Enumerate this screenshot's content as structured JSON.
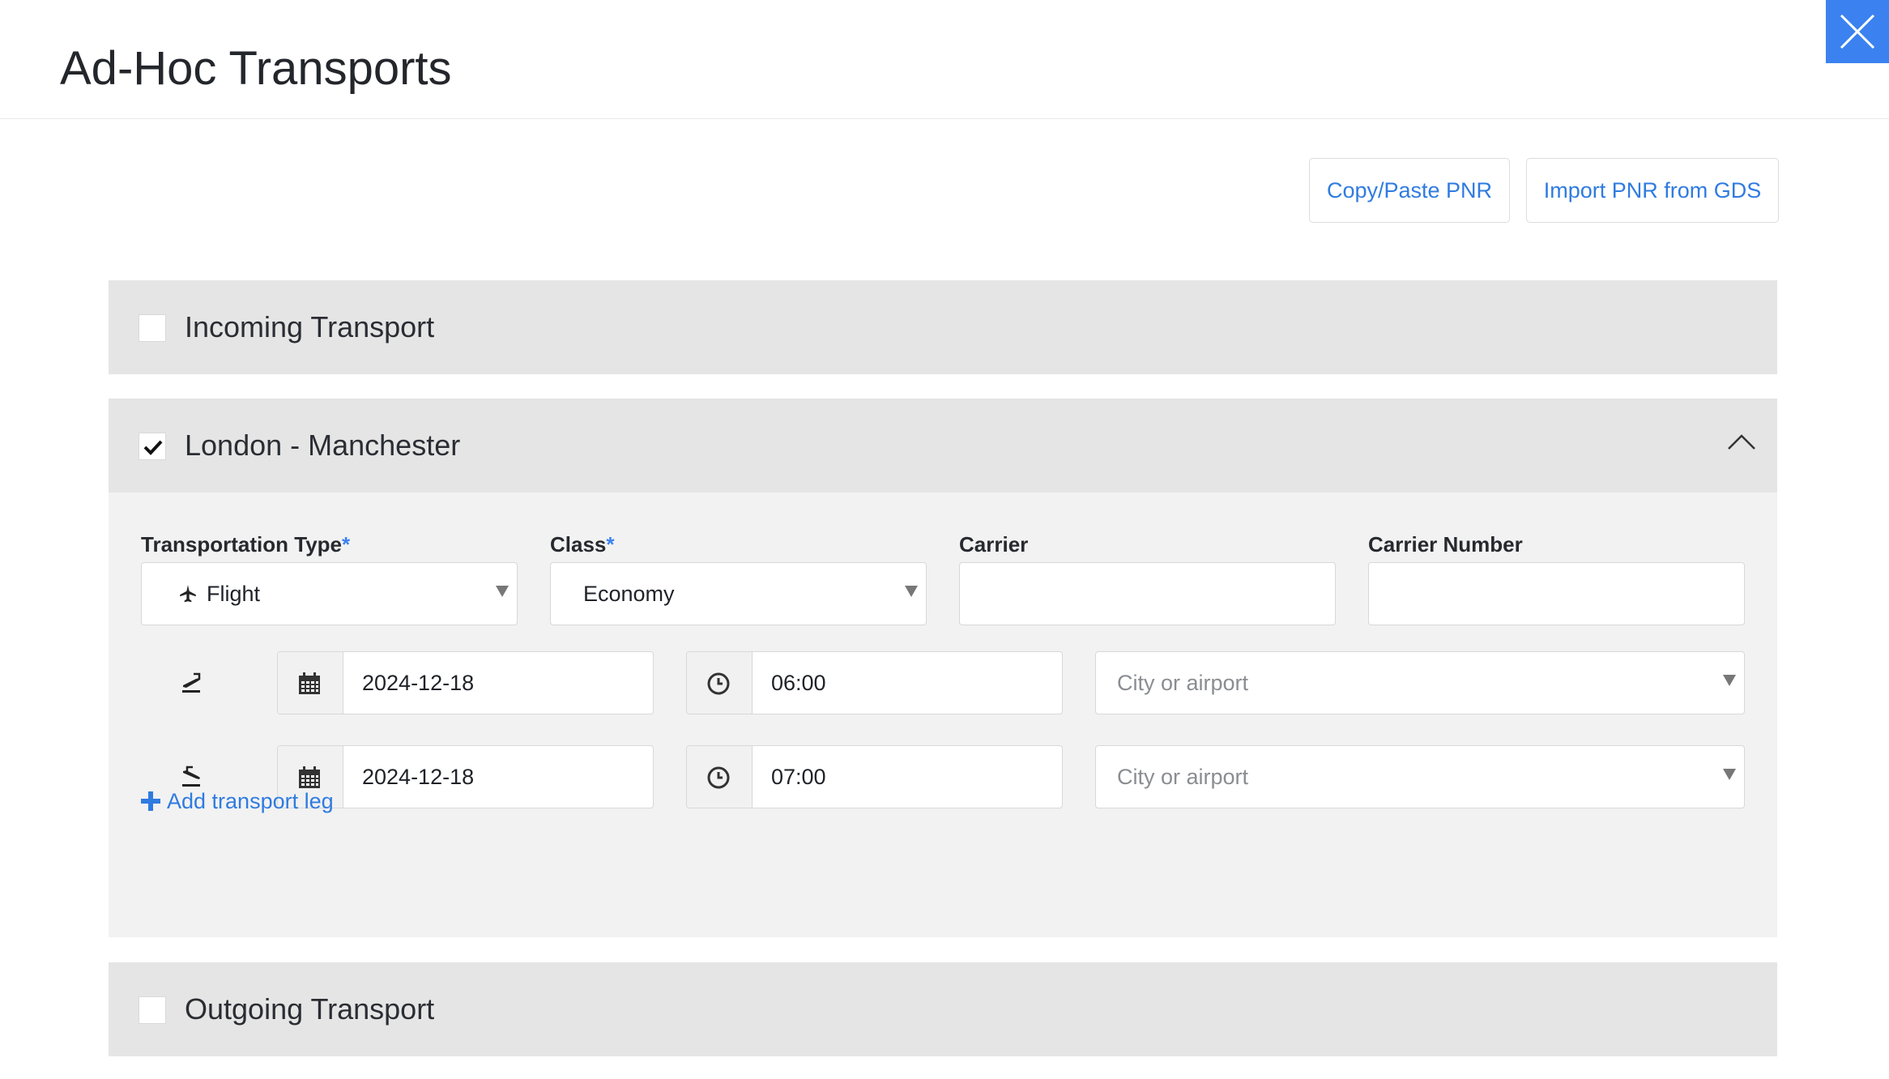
{
  "page": {
    "title": "Ad-Hoc Transports"
  },
  "toolbar": {
    "copy_paste_pnr": "Copy/Paste PNR",
    "import_pnr": "Import PNR from GDS"
  },
  "sections": {
    "incoming": {
      "title": "Incoming Transport",
      "checked": false
    },
    "segment": {
      "title": "London - Manchester",
      "checked": true,
      "expanded": true,
      "labels": {
        "transportation_type": "Transportation Type",
        "class": "Class",
        "carrier": "Carrier",
        "carrier_number": "Carrier Number",
        "required_mark": "*"
      },
      "values": {
        "transportation_type": "Flight",
        "class": "Economy",
        "carrier": "",
        "carrier_number": ""
      },
      "departure": {
        "date": "2024-12-18",
        "time": "06:00",
        "location_placeholder": "City or airport",
        "icon": "plane-departure-icon"
      },
      "arrival": {
        "date": "2024-12-18",
        "time": "07:00",
        "location_placeholder": "City or airport",
        "icon": "plane-arrival-icon"
      },
      "add_leg_label": "Add transport leg"
    },
    "outgoing": {
      "title": "Outgoing Transport",
      "checked": false
    }
  },
  "colors": {
    "accent": "#3b82f0",
    "link": "#2f7be0",
    "panel_header": "#e5e5e5",
    "panel_body": "#f2f2f2"
  }
}
